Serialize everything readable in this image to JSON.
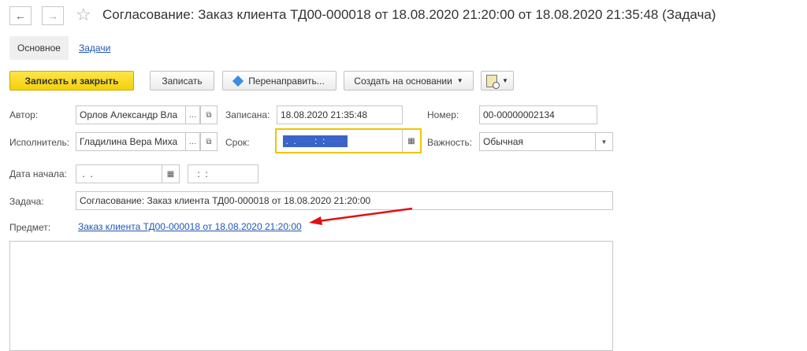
{
  "header": {
    "back_icon": "arrow-left-icon",
    "forward_icon": "arrow-right-icon",
    "favorite_icon": "star-icon",
    "title": "Согласование: Заказ клиента ТД00-000018 от 18.08.2020 21:20:00 от 18.08.2020 21:35:48 (Задача)"
  },
  "tabs": {
    "main": "Основное",
    "tasks": "Задачи"
  },
  "toolbar": {
    "save_close": "Записать и закрыть",
    "save": "Записать",
    "redirect": "Перенаправить...",
    "create_based": "Создать на основании",
    "print_icon": "print-icon"
  },
  "form": {
    "author_label": "Автор:",
    "author_value": "Орлов Александр Вла",
    "written_label": "Записана:",
    "written_value": "18.08.2020 21:35:48",
    "number_label": "Номер:",
    "number_value": "00-00000002134",
    "executor_label": "Исполнитель:",
    "executor_value": "Гладилина Вера Миха",
    "deadline_label": "Срок:",
    "deadline_value": " .  .       :  :",
    "importance_label": "Важность:",
    "importance_value": "Обычная",
    "start_label": "Дата начала:",
    "start_date_value": " .  .",
    "start_time_value": " :  :",
    "task_label": "Задача:",
    "task_value": "Согласование: Заказ клиента ТД00-000018 от 18.08.2020 21:20:00",
    "subject_label": "Предмет:",
    "subject_link": "Заказ клиента ТД00-000018 от 18.08.2020 21:20:00",
    "description_value": ""
  },
  "colors": {
    "primary_button": "#f5d108",
    "focus_border": "#f0c400",
    "link": "#2356b4",
    "annotation_arrow": "#e01010",
    "selection": "#3b64c8"
  }
}
